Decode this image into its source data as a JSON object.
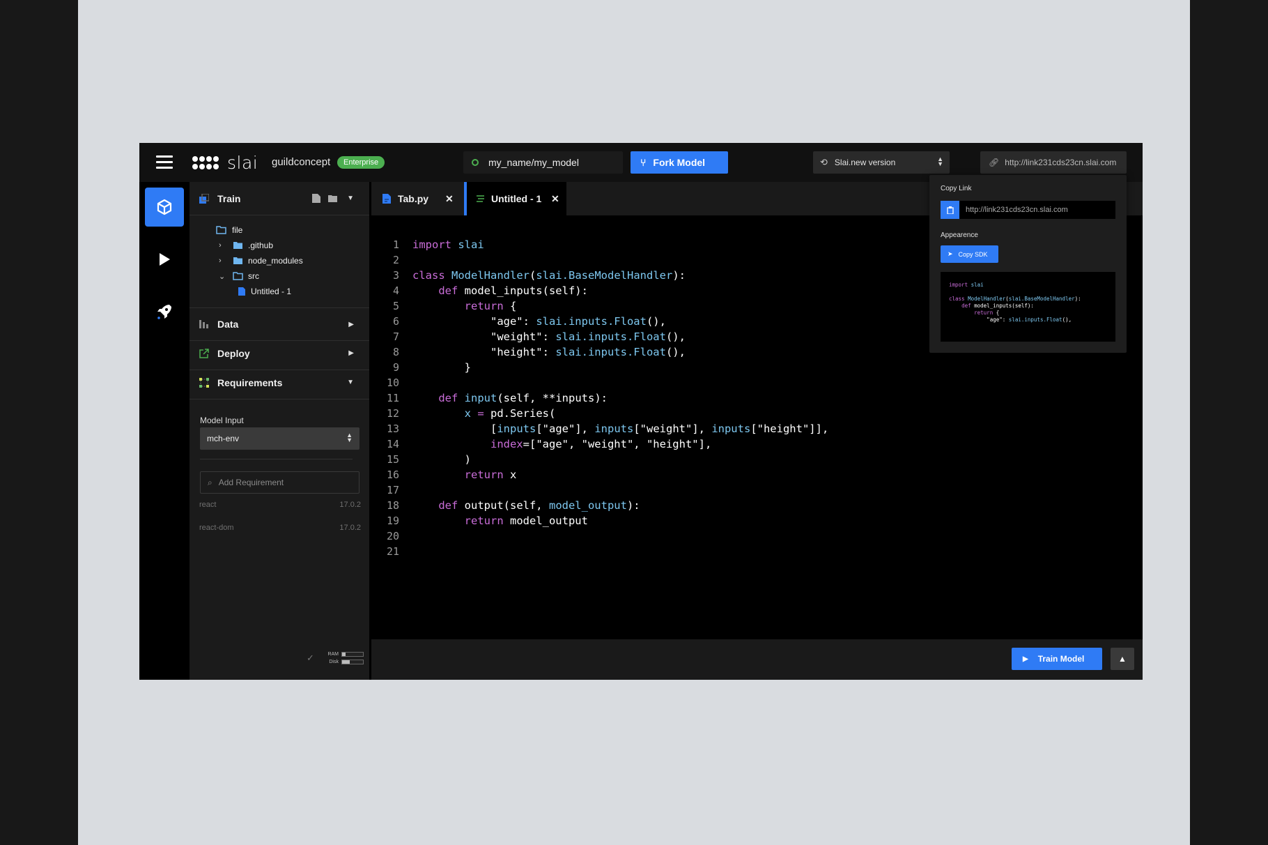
{
  "header": {
    "logo_text": "slai",
    "org_name": "guildconcept",
    "plan_badge": "Enterprise",
    "model_path": "my_name/my_model",
    "fork_button": "Fork Model",
    "version_select": "Slai.new version",
    "share_link": "http://link231cds23cn.slai.com"
  },
  "rail": {
    "items": [
      {
        "icon": "cube-icon",
        "active": true
      },
      {
        "icon": "play-icon",
        "active": false
      },
      {
        "icon": "rocket-icon",
        "active": false
      }
    ]
  },
  "sidebar": {
    "train": {
      "title": "Train",
      "tree": [
        {
          "name": "file",
          "type": "folder-open",
          "depth": 0
        },
        {
          "name": ".github",
          "type": "folder",
          "depth": 1,
          "chevron": "right"
        },
        {
          "name": "node_modules",
          "type": "folder",
          "depth": 1,
          "chevron": "right"
        },
        {
          "name": "src",
          "type": "folder-open",
          "depth": 1,
          "chevron": "down"
        },
        {
          "name": "Untitled - 1",
          "type": "file",
          "depth": 2
        }
      ]
    },
    "data_title": "Data",
    "deploy_title": "Deploy",
    "requirements_title": "Requirements",
    "model_input_label": "Model Input",
    "model_input_value": "mch-env",
    "add_requirement_placeholder": "Add Requirement",
    "requirements": [
      {
        "name": "react",
        "version": "17.0.2"
      },
      {
        "name": "react-dom",
        "version": "17.0.2"
      }
    ],
    "resources": {
      "ram_label": "RAM",
      "disk_label": "Disk",
      "ram_fraction": 0.15,
      "disk_fraction": 0.35
    }
  },
  "tabs": [
    {
      "label": "Tab.py",
      "active": false
    },
    {
      "label": "Untitled - 1",
      "active": true
    }
  ],
  "editor": {
    "line_numbers": [
      "1",
      "2",
      "3",
      "4",
      "5",
      "6",
      "7",
      "8",
      "9",
      "10",
      "11",
      "12",
      "13",
      "14",
      "15",
      "16",
      "17",
      "18",
      "19",
      "20",
      "21"
    ],
    "lines": [
      [
        [
          "kw",
          "import"
        ],
        [
          "t",
          " "
        ],
        [
          "cls",
          "slai"
        ]
      ],
      [],
      [
        [
          "kw",
          "class"
        ],
        [
          "t",
          " "
        ],
        [
          "cls",
          "ModelHandler"
        ],
        [
          "t",
          "("
        ],
        [
          "cls",
          "slai.BaseModelHandler"
        ],
        [
          "t",
          "):"
        ]
      ],
      [
        [
          "t",
          "    "
        ],
        [
          "kw",
          "def"
        ],
        [
          "t",
          " model_inputs(self):"
        ]
      ],
      [
        [
          "t",
          "        "
        ],
        [
          "kw",
          "return"
        ],
        [
          "t",
          " {"
        ]
      ],
      [
        [
          "t",
          "            \"age\": "
        ],
        [
          "cls",
          "slai.inputs.Float"
        ],
        [
          "t",
          "(),"
        ]
      ],
      [
        [
          "t",
          "            \"weight\": "
        ],
        [
          "cls",
          "slai.inputs.Float"
        ],
        [
          "t",
          "(),"
        ]
      ],
      [
        [
          "t",
          "            \"height\": "
        ],
        [
          "cls",
          "slai.inputs.Float"
        ],
        [
          "t",
          "(),"
        ]
      ],
      [
        [
          "t",
          "        }"
        ]
      ],
      [],
      [
        [
          "t",
          "    "
        ],
        [
          "kw",
          "def"
        ],
        [
          "t",
          " "
        ],
        [
          "cls",
          "input"
        ],
        [
          "t",
          "(self, **inputs):"
        ]
      ],
      [
        [
          "t",
          "        "
        ],
        [
          "cls",
          "x"
        ],
        [
          "t",
          " "
        ],
        [
          "kw",
          "="
        ],
        [
          "t",
          " pd.Series("
        ]
      ],
      [
        [
          "t",
          "            ["
        ],
        [
          "cls",
          "inputs"
        ],
        [
          "t",
          "[\"age\"], "
        ],
        [
          "cls",
          "inputs"
        ],
        [
          "t",
          "[\"weight\"], "
        ],
        [
          "cls",
          "inputs"
        ],
        [
          "t",
          "[\"height\"]],"
        ]
      ],
      [
        [
          "t",
          "            "
        ],
        [
          "kw",
          "index"
        ],
        [
          "t",
          "=[\"age\", \"weight\", \"height\"],"
        ]
      ],
      [
        [
          "t",
          "        )"
        ]
      ],
      [
        [
          "t",
          "        "
        ],
        [
          "kw",
          "return"
        ],
        [
          "t",
          " x"
        ]
      ],
      [],
      [
        [
          "t",
          "    "
        ],
        [
          "kw",
          "def"
        ],
        [
          "t",
          " output(self, "
        ],
        [
          "cls",
          "model_output"
        ],
        [
          "t",
          "):"
        ]
      ],
      [
        [
          "t",
          "        "
        ],
        [
          "kw",
          "return"
        ],
        [
          "t",
          " model_output"
        ]
      ],
      [],
      []
    ]
  },
  "footer": {
    "train_button": "Train Model"
  },
  "share_popover": {
    "copy_link_label": "Copy Link",
    "link": "http://link231cds23cn.slai.com",
    "appearance_label": "Appearence",
    "copy_sdk_button": "Copy SDK",
    "sdk_preview": [
      [
        [
          "kw",
          "import"
        ],
        [
          "t",
          " "
        ],
        [
          "cls",
          "slai"
        ]
      ],
      [],
      [
        [
          "kw",
          "class"
        ],
        [
          "t",
          " "
        ],
        [
          "cls",
          "ModelHandler"
        ],
        [
          "t",
          "("
        ],
        [
          "cls",
          "slai.BaseModelHandler"
        ],
        [
          "t",
          "):"
        ]
      ],
      [
        [
          "t",
          "    "
        ],
        [
          "kw",
          "def"
        ],
        [
          "t",
          " model_inputs(self):"
        ]
      ],
      [
        [
          "t",
          "        "
        ],
        [
          "kw",
          "return"
        ],
        [
          "t",
          " {"
        ]
      ],
      [
        [
          "t",
          "            \"age\": "
        ],
        [
          "cls",
          "slai.inputs.Float"
        ],
        [
          "t",
          "(),"
        ]
      ]
    ]
  },
  "colors": {
    "accent": "#2f7bf5",
    "badge": "#4caf50",
    "keyword": "#c96dd8",
    "identifier": "#7ec8f0"
  }
}
